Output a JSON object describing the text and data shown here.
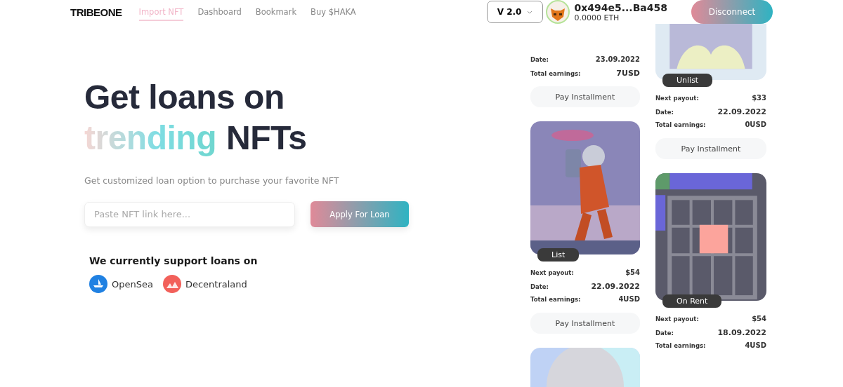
{
  "logo": "TRIBEONE",
  "nav": [
    {
      "label": "Import NFT",
      "selected": true
    },
    {
      "label": "Dashboard",
      "selected": false
    },
    {
      "label": "Bookmark",
      "selected": false
    },
    {
      "label": "Buy $HAKA",
      "selected": false
    }
  ],
  "version": "V 2.0",
  "wallet": {
    "address": "0x494e5...Ba458",
    "balance": "0.0000 ETH"
  },
  "disconnect": "Disconnect",
  "hero": {
    "line1": "Get loans on",
    "highlight": "trending",
    "rest": "NFTs",
    "subtitle": "Get customized loan option to purchase your favorite NFT",
    "placeholder": "Paste NFT link here...",
    "apply": "Apply For Loan"
  },
  "support": {
    "title": "We currently support loans on",
    "platforms": [
      {
        "name": "OpenSea",
        "color": "#2081e2"
      },
      {
        "name": "Decentraland",
        "color": "#f2605a"
      }
    ]
  },
  "columns": [
    [
      {
        "rows": [
          {
            "label": "Date:",
            "value": "23.09.2022"
          },
          {
            "label": "Total earnings:",
            "value": "7USD"
          }
        ],
        "button": "Pay Installment"
      },
      {
        "kind": "picture",
        "badge": "List",
        "rows": [
          {
            "label": "Next payout:",
            "value": "$54"
          },
          {
            "label": "Date:",
            "value": "22.09.2022"
          },
          {
            "label": "Total earnings:",
            "value": "4USD"
          }
        ],
        "button": "Pay Installment"
      },
      {
        "kind": "picture"
      }
    ],
    [
      {
        "kind": "picture",
        "badge": "Unlist",
        "rows": [
          {
            "label": "Next payout:",
            "value": "$33"
          },
          {
            "label": "Date:",
            "value": "22.09.2022"
          },
          {
            "label": "Total earnings:",
            "value": "0USD"
          }
        ],
        "button": "Pay Installment"
      },
      {
        "kind": "picture",
        "badge": "On Rent",
        "rows": [
          {
            "label": "Next payout:",
            "value": "$54"
          },
          {
            "label": "Date:",
            "value": "18.09.2022"
          },
          {
            "label": "Total earnings:",
            "value": "4USD"
          }
        ]
      }
    ]
  ]
}
